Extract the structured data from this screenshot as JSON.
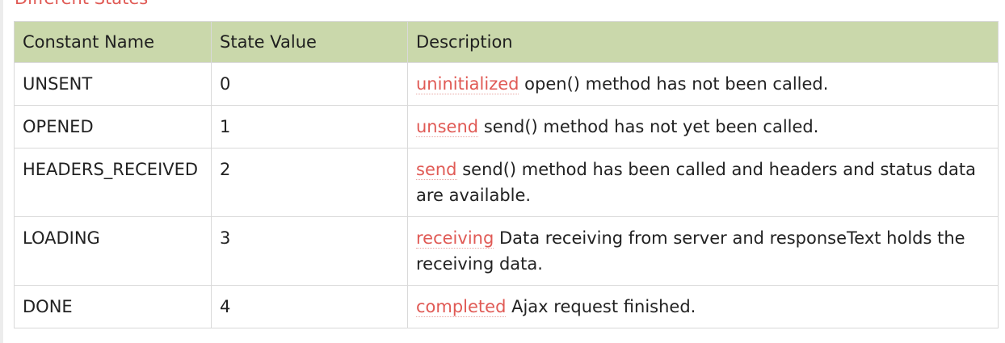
{
  "heading": "Different States",
  "table": {
    "headers": [
      "Constant Name",
      "State Value",
      "Description"
    ],
    "rows": [
      {
        "name": "UNSENT",
        "value": "0",
        "term": "uninitialized",
        "desc": "open() method has not been called."
      },
      {
        "name": "OPENED",
        "value": "1",
        "term": "unsend",
        "desc": "send() method has not yet been called."
      },
      {
        "name": "HEADERS_RECEIVED",
        "value": "2",
        "term": "send",
        "desc": "send() method has been called and headers and status data are available."
      },
      {
        "name": "LOADING",
        "value": "3",
        "term": "receiving",
        "desc": "Data receiving from server and responseText holds the receiving data."
      },
      {
        "name": "DONE",
        "value": "4",
        "term": "completed",
        "desc": "Ajax request finished."
      }
    ]
  },
  "colors": {
    "header_bg": "#cad8ab",
    "accent": "#e05a55",
    "border": "#d9d9d9"
  }
}
